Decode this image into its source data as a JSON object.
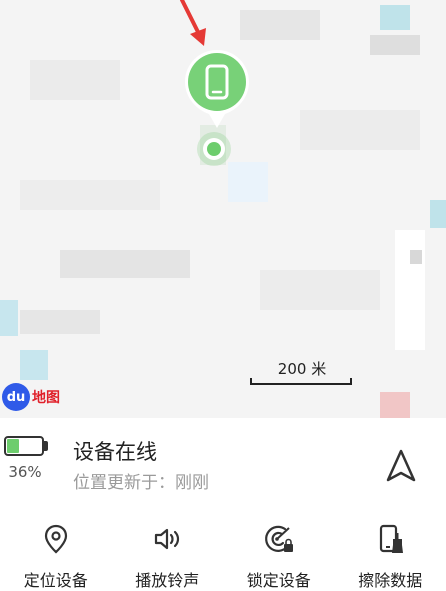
{
  "map": {
    "scale_label": "200 米",
    "logo_mark": "du",
    "logo_text": "地图",
    "pin_icon": "phone-icon",
    "colors": {
      "pin": "#78d178",
      "arrow": "#e53935",
      "logo_red": "#e0202a",
      "logo_blue": "#2f5ae8"
    }
  },
  "device": {
    "battery_percent": "36%",
    "battery_level": 0.36,
    "status": "设备在线",
    "location_updated": "位置更新于：刚刚"
  },
  "actions": [
    {
      "label": "定位设备",
      "icon": "location-pin-icon"
    },
    {
      "label": "播放铃声",
      "icon": "speaker-icon"
    },
    {
      "label": "锁定设备",
      "icon": "lock-target-icon"
    },
    {
      "label": "擦除数据",
      "icon": "erase-phone-icon"
    }
  ]
}
